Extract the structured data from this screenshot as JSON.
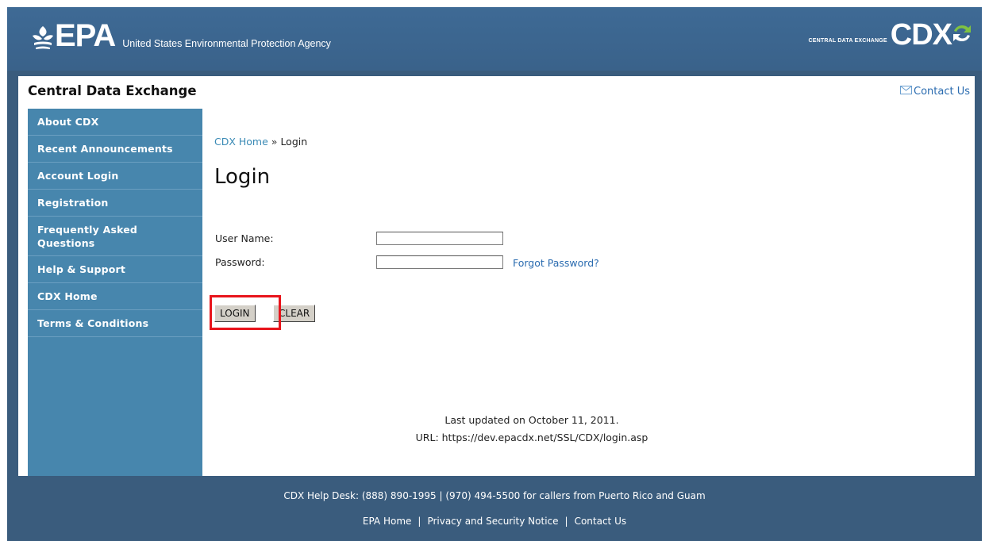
{
  "header": {
    "epa_logo_text": "EPA",
    "agency_name": "United States Environmental Protection Agency",
    "cdx_subtitle": "CENTRAL DATA EXCHANGE",
    "cdx_logo_text": "CDX"
  },
  "site_title": "Central Data Exchange",
  "contact_top": {
    "icon": "envelope-icon",
    "label": "Contact Us"
  },
  "sidebar": {
    "items": [
      {
        "label": "About CDX"
      },
      {
        "label": "Recent Announcements"
      },
      {
        "label": "Account Login"
      },
      {
        "label": "Registration"
      },
      {
        "label": "Frequently Asked Questions"
      },
      {
        "label": "Help & Support"
      },
      {
        "label": "CDX Home"
      },
      {
        "label": "Terms & Conditions"
      }
    ]
  },
  "breadcrumb": {
    "home": "CDX Home",
    "separator": "»",
    "current": "Login"
  },
  "page_title": "Login",
  "form": {
    "username_label": "User Name:",
    "username_value": "",
    "password_label": "Password:",
    "password_value": "",
    "forgot_label": "Forgot Password?",
    "login_button": "LOGIN",
    "clear_button": "CLEAR"
  },
  "updated": {
    "last_updated": "Last updated on October 11, 2011.",
    "url": "URL: https://dev.epacdx.net/SSL/CDX/login.asp"
  },
  "footer": {
    "help_desk": "CDX Help Desk: (888) 890-1995 | (970) 494-5500 for callers from Puerto Rico and Guam",
    "links": [
      "EPA Home",
      "Privacy and Security Notice",
      "Contact Us"
    ]
  },
  "colors": {
    "header_bg": "#3e6a95",
    "sidebar_bg": "#4786ad",
    "link": "#2b6cb0",
    "highlight": "#e8141b"
  }
}
